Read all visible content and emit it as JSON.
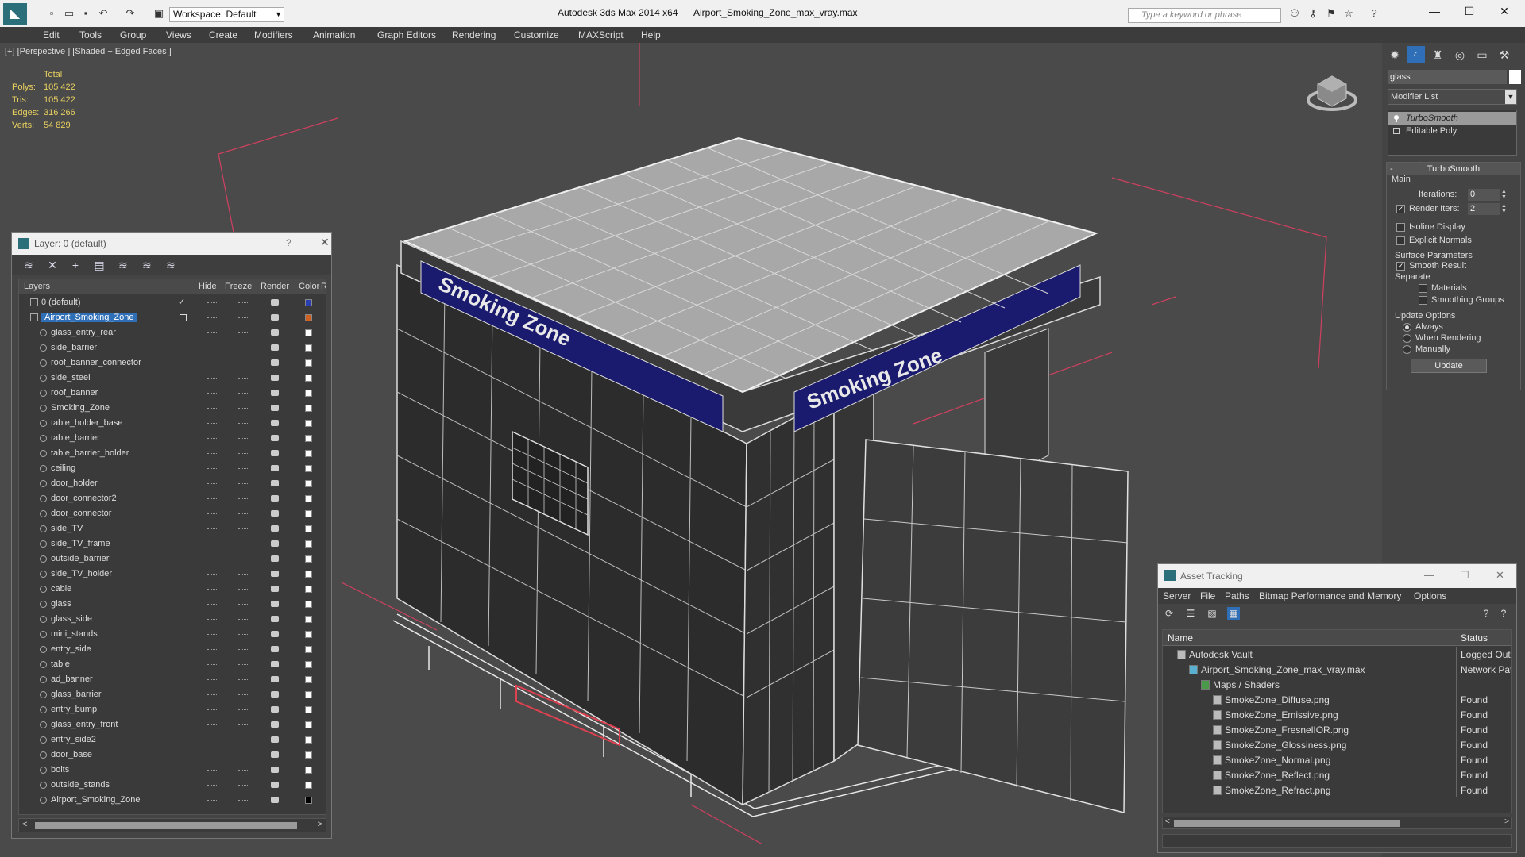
{
  "app": {
    "title": "Autodesk 3ds Max  2014 x64",
    "file": "Airport_Smoking_Zone_max_vray.max",
    "workspace": "Workspace: Default",
    "search_placeholder": "Type a keyword or phrase"
  },
  "menu": [
    "Edit",
    "Tools",
    "Group",
    "Views",
    "Create",
    "Modifiers",
    "Animation",
    "Graph Editors",
    "Rendering",
    "Customize",
    "MAXScript",
    "Help"
  ],
  "viewport": {
    "label": "[+] [Perspective ] [Shaded + Edged Faces ]",
    "stats": {
      "header": "Total",
      "rows": [
        {
          "k": "Polys:",
          "v": "105 422"
        },
        {
          "k": "Tris:",
          "v": "105 422"
        },
        {
          "k": "Edges:",
          "v": "316 266"
        },
        {
          "k": "Verts:",
          "v": "54 829"
        }
      ]
    },
    "banner_text": "Smoking Zone"
  },
  "layer_panel": {
    "title": "Layer: 0 (default)",
    "help": "?",
    "columns": {
      "layers": "Layers",
      "hide": "Hide",
      "freeze": "Freeze",
      "render": "Render",
      "color": "Color",
      "radiosity": "R"
    },
    "rows": [
      {
        "name": "0 (default)",
        "level": 0,
        "color": "#2a3fb0",
        "check": "✓"
      },
      {
        "name": "Airport_Smoking_Zone",
        "level": 0,
        "color": "#d06020",
        "selected": true
      },
      {
        "name": "glass_entry_rear",
        "level": 1,
        "color": "#ffffff"
      },
      {
        "name": "side_barrier",
        "level": 1,
        "color": "#ffffff"
      },
      {
        "name": "roof_banner_connector",
        "level": 1,
        "color": "#ffffff"
      },
      {
        "name": "side_steel",
        "level": 1,
        "color": "#ffffff"
      },
      {
        "name": "roof_banner",
        "level": 1,
        "color": "#ffffff"
      },
      {
        "name": "Smoking_Zone",
        "level": 1,
        "color": "#ffffff"
      },
      {
        "name": "table_holder_base",
        "level": 1,
        "color": "#ffffff"
      },
      {
        "name": "table_barrier",
        "level": 1,
        "color": "#ffffff"
      },
      {
        "name": "table_barrier_holder",
        "level": 1,
        "color": "#ffffff"
      },
      {
        "name": "ceiling",
        "level": 1,
        "color": "#ffffff"
      },
      {
        "name": "door_holder",
        "level": 1,
        "color": "#ffffff"
      },
      {
        "name": "door_connector2",
        "level": 1,
        "color": "#ffffff"
      },
      {
        "name": "door_connector",
        "level": 1,
        "color": "#ffffff"
      },
      {
        "name": "side_TV",
        "level": 1,
        "color": "#ffffff"
      },
      {
        "name": "side_TV_frame",
        "level": 1,
        "color": "#ffffff"
      },
      {
        "name": "outside_barrier",
        "level": 1,
        "color": "#ffffff"
      },
      {
        "name": "side_TV_holder",
        "level": 1,
        "color": "#ffffff"
      },
      {
        "name": "cable",
        "level": 1,
        "color": "#ffffff"
      },
      {
        "name": "glass",
        "level": 1,
        "color": "#ffffff"
      },
      {
        "name": "glass_side",
        "level": 1,
        "color": "#ffffff"
      },
      {
        "name": "mini_stands",
        "level": 1,
        "color": "#ffffff"
      },
      {
        "name": "entry_side",
        "level": 1,
        "color": "#ffffff"
      },
      {
        "name": "table",
        "level": 1,
        "color": "#ffffff"
      },
      {
        "name": "ad_banner",
        "level": 1,
        "color": "#ffffff"
      },
      {
        "name": "glass_barrier",
        "level": 1,
        "color": "#ffffff"
      },
      {
        "name": "entry_bump",
        "level": 1,
        "color": "#ffffff"
      },
      {
        "name": "glass_entry_front",
        "level": 1,
        "color": "#ffffff"
      },
      {
        "name": "entry_side2",
        "level": 1,
        "color": "#ffffff"
      },
      {
        "name": "door_base",
        "level": 1,
        "color": "#ffffff"
      },
      {
        "name": "bolts",
        "level": 1,
        "color": "#ffffff"
      },
      {
        "name": "outside_stands",
        "level": 1,
        "color": "#ffffff"
      },
      {
        "name": "Airport_Smoking_Zone",
        "level": 1,
        "color": "#000000"
      }
    ]
  },
  "command_panel": {
    "object_name": "glass",
    "modifier_list": "Modifier List",
    "stack": [
      {
        "name": "TurboSmooth",
        "active": true
      },
      {
        "name": "Editable Poly",
        "active": false
      }
    ],
    "turbosmooth": {
      "title": "TurboSmooth",
      "main": "Main",
      "iterations_label": "Iterations:",
      "iterations": "0",
      "render_iters_label": "Render Iters:",
      "render_iters": "2",
      "render_iters_checked": true,
      "isoline": "Isoline Display",
      "explicit_normals": "Explicit Normals",
      "surface_params": "Surface Parameters",
      "smooth_result": "Smooth Result",
      "separate": "Separate",
      "materials": "Materials",
      "smoothing_groups": "Smoothing Groups",
      "update_options": "Update Options",
      "always": "Always",
      "when_rendering": "When Rendering",
      "manually": "Manually",
      "update_button": "Update"
    }
  },
  "asset_tracking": {
    "title": "Asset Tracking",
    "menu": [
      "Server",
      "File",
      "Paths",
      "Bitmap Performance and Memory",
      "Options"
    ],
    "columns": {
      "name": "Name",
      "status": "Status"
    },
    "rows": [
      {
        "name": "Autodesk Vault",
        "status": "Logged Out",
        "level": 0
      },
      {
        "name": "Airport_Smoking_Zone_max_vray.max",
        "status": "Network Pat",
        "level": 1
      },
      {
        "name": "Maps / Shaders",
        "status": "",
        "level": 2
      },
      {
        "name": "SmokeZone_Diffuse.png",
        "status": "Found",
        "level": 3
      },
      {
        "name": "SmokeZone_Emissive.png",
        "status": "Found",
        "level": 3
      },
      {
        "name": "SmokeZone_FresnelIOR.png",
        "status": "Found",
        "level": 3
      },
      {
        "name": "SmokeZone_Glossiness.png",
        "status": "Found",
        "level": 3
      },
      {
        "name": "SmokeZone_Normal.png",
        "status": "Found",
        "level": 3
      },
      {
        "name": "SmokeZone_Reflect.png",
        "status": "Found",
        "level": 3
      },
      {
        "name": "SmokeZone_Refract.png",
        "status": "Found",
        "level": 3
      }
    ]
  },
  "colors": {
    "accent": "#2f6fb7",
    "banner": "#1a1a6e",
    "stats": "#e8d060",
    "grid_red": "#d04060"
  }
}
